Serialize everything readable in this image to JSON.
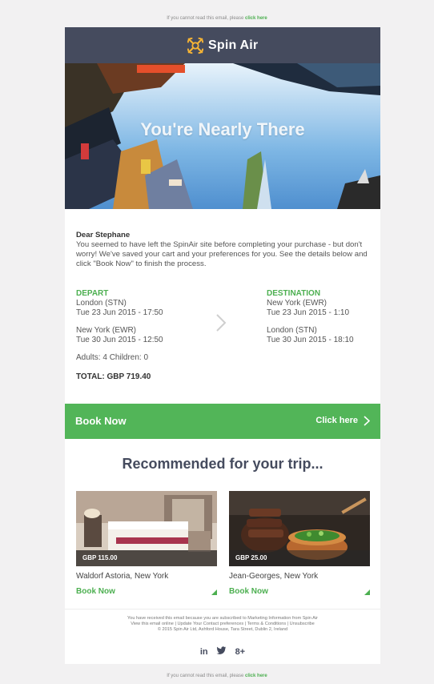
{
  "top_note": {
    "text": "If you cannot read this email, please",
    "link": "click here"
  },
  "bottom_note": {
    "text": "If you cannot read this email, please",
    "link": "click here"
  },
  "header": {
    "brand": "Spin Air",
    "icon": "spin-air-logo-icon"
  },
  "hero": {
    "title": "You're Nearly There"
  },
  "greeting": {
    "name": "Dear Stephane",
    "body": "You seemed to have left the SpinAir site before completing your purchase - but don't worry! We've saved your cart and your preferences for you. See the details below and click \"Book Now\" to finish the process."
  },
  "depart": {
    "heading": "DEPART",
    "out_place": "London (STN)",
    "out_time": "Tue 23 Jun 2015 - 17:50",
    "ret_place": "New York (EWR)",
    "ret_time": "Tue 30 Jun 2015 - 12:50"
  },
  "destination": {
    "heading": "DESTINATION",
    "out_place": "New York (EWR)",
    "out_time": "Tue 23 Jun 2015 - 1:10",
    "ret_place": "London (STN)",
    "ret_time": "Tue 30 Jun 2015 - 18:10"
  },
  "passengers": "Adults: 4  Children: 0",
  "total": "TOTAL: GBP 719.40",
  "cta": {
    "label": "Book Now",
    "link": "Click here",
    "icon": "chevron-right-icon"
  },
  "recommended": {
    "title": "Recommended for your trip...",
    "items": [
      {
        "price": "GBP 115.00",
        "name": "Waldorf Astoria, New York",
        "book": "Book Now"
      },
      {
        "price": "GBP 25.00",
        "name": "Jean-Georges, New York",
        "book": "Book Now"
      }
    ]
  },
  "footer": {
    "line1": "You have received this email because you are subscribed to Marketing Information from Spin Air",
    "line2": "View this email online | Update Your Contact preferences | Terms & Conditions | Unsubscribe",
    "line3": "© 2015 Spin Air Ltd, Ashford House, Tara Street, Dublin 2, Ireland"
  },
  "social": {
    "linkedin": "in",
    "twitter": "twitter-icon",
    "googleplus": "8+"
  },
  "colors": {
    "accent": "#52b558",
    "header": "#454b5e"
  }
}
